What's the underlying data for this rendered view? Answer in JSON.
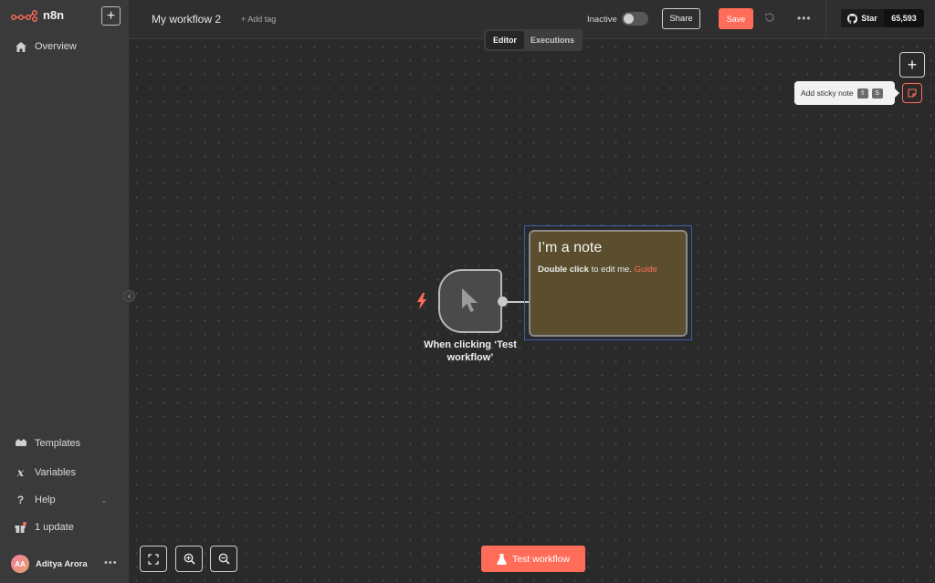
{
  "app": {
    "name": "n8n"
  },
  "sidebar": {
    "new_label": "+",
    "items": [
      {
        "label": "Overview",
        "icon": "home-icon"
      },
      {
        "label": "Templates",
        "icon": "templates-icon"
      },
      {
        "label": "Variables",
        "icon": "variables-icon"
      },
      {
        "label": "Help",
        "icon": "help-icon"
      },
      {
        "label": "1 update",
        "icon": "gift-icon"
      }
    ],
    "user": {
      "initials": "AA",
      "name": "Aditya Arora"
    }
  },
  "header": {
    "workflow_name": "My workflow 2",
    "add_tag": "+ Add tag",
    "active_label": "Inactive",
    "active": false,
    "share_label": "Share",
    "save_label": "Save",
    "github": {
      "star_label": "Star",
      "count": "65,593"
    }
  },
  "tabs": [
    {
      "label": "Editor",
      "active": true
    },
    {
      "label": "Executions",
      "active": false
    }
  ],
  "canvas": {
    "tooltip": {
      "label": "Add sticky note",
      "keys": [
        "⇧",
        "S"
      ]
    },
    "node": {
      "label": "When clicking ‘Test workflow’"
    },
    "sticky": {
      "title": "I’m a note",
      "body_bold": "Double click",
      "body_text": " to edit me. ",
      "body_link": "Guide"
    },
    "test_button": "Test workflow"
  },
  "colors": {
    "accent": "#ff6d5a",
    "sticky_bg": "#5a4e2e",
    "sidebar_bg": "#3a3a3a"
  }
}
